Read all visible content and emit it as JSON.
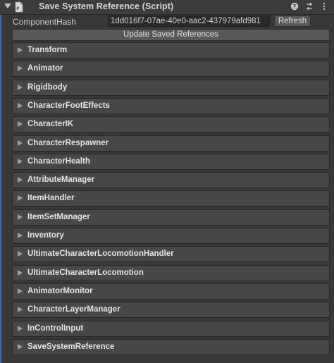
{
  "header": {
    "title": "Save System Reference (Script)",
    "icons": [
      "foldout-arrow-icon",
      "script-icon",
      "help-icon",
      "presets-icon",
      "more-options-icon"
    ]
  },
  "hash": {
    "label": "ComponentHash",
    "value": "1dd016f7-07ae-40e0-aac2-437979afd981",
    "refresh_label": "Refresh"
  },
  "update_button": {
    "label": "Update Saved References"
  },
  "components": [
    {
      "label": "Transform"
    },
    {
      "label": "Animator"
    },
    {
      "label": "Rigidbody"
    },
    {
      "label": "CharacterFootEffects"
    },
    {
      "label": "CharacterIK"
    },
    {
      "label": "CharacterRespawner"
    },
    {
      "label": "CharacterHealth"
    },
    {
      "label": "AttributeManager"
    },
    {
      "label": "ItemHandler"
    },
    {
      "label": "ItemSetManager"
    },
    {
      "label": "Inventory"
    },
    {
      "label": "UltimateCharacterLocomotionHandler"
    },
    {
      "label": "UltimateCharacterLocomotion"
    },
    {
      "label": "AnimatorMonitor"
    },
    {
      "label": "CharacterLayerManager"
    },
    {
      "label": "InControlInput"
    },
    {
      "label": "SaveSystemReference"
    }
  ],
  "colors": {
    "background": "#383838",
    "row": "#474747",
    "button": "#585858",
    "field": "#2a2a2a",
    "accent": "#4a6aa0"
  }
}
